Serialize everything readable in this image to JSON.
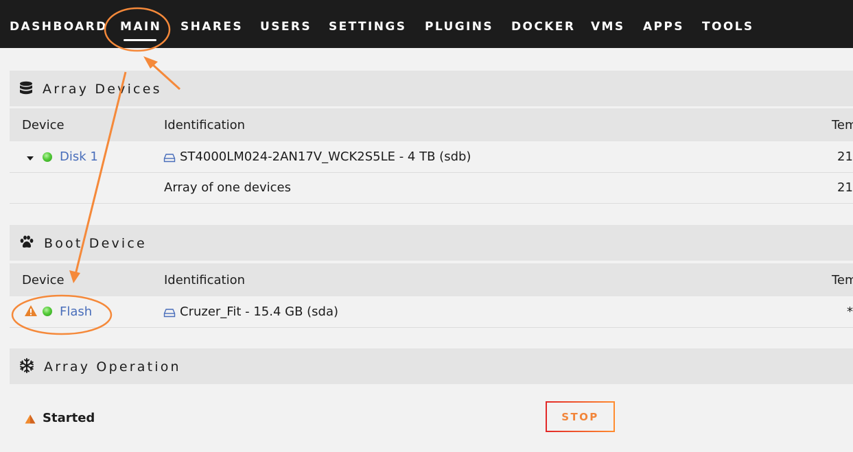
{
  "nav": {
    "items": [
      "DASHBOARD",
      "MAIN",
      "SHARES",
      "USERS",
      "SETTINGS",
      "PLUGINS",
      "DOCKER",
      "VMS",
      "APPS",
      "TOOLS"
    ],
    "active": "MAIN"
  },
  "array_devices": {
    "title": "Array Devices",
    "icon": "database-icon",
    "columns": {
      "device": "Device",
      "identification": "Identification",
      "temp": "Tem"
    },
    "rows": [
      {
        "device": "Disk 1",
        "identification": "ST4000LM024-2AN17V_WCK2S5LE - 4 TB (sdb)",
        "temp": "21",
        "status": "green"
      },
      {
        "device": "",
        "identification": "Array of one devices",
        "temp": "21"
      }
    ]
  },
  "boot_device": {
    "title": "Boot Device",
    "icon": "paw-icon",
    "columns": {
      "device": "Device",
      "identification": "Identification",
      "temp": "Tem"
    },
    "rows": [
      {
        "device": "Flash",
        "identification": "Cruzer_Fit - 15.4 GB (sda)",
        "temp": "*",
        "status": "green",
        "warning": true
      }
    ]
  },
  "array_operation": {
    "title": "Array Operation",
    "icon": "snowflake-icon",
    "status": "Started",
    "stop_label": "STOP"
  },
  "colors": {
    "navbar": "#1c1c1c",
    "background": "#f2f2f2",
    "header": "#e4e4e4",
    "link": "#486dba",
    "annotation": "#f5893a",
    "status_green": "#55cc3a"
  }
}
